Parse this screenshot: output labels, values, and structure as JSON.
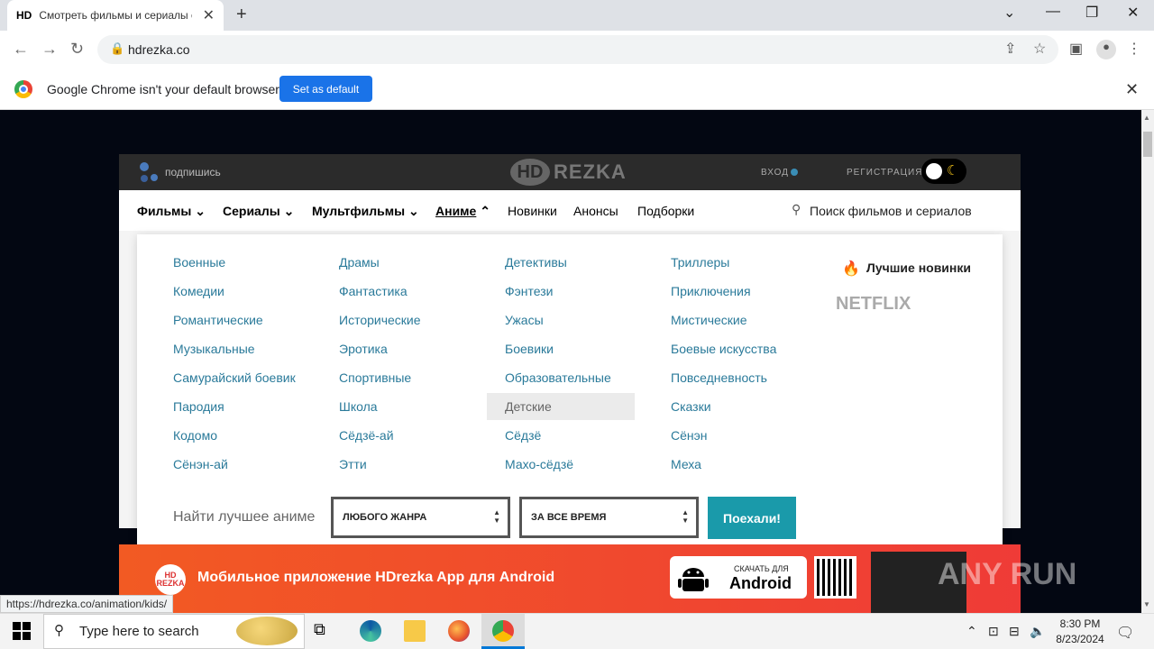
{
  "browser": {
    "tab_favicon": "HD",
    "tab_title": "Смотреть фильмы и сериалы о",
    "new_tab": "+",
    "url": "hdrezka.co",
    "infobar_text": "Google Chrome isn't your default browser",
    "set_default": "Set as default",
    "status_url": "https://hdrezka.co/animation/kids/"
  },
  "site": {
    "subscribe": "подпишись",
    "logo_hd": "HD",
    "logo_rezka": "REZKA",
    "login": "ВХОД",
    "register": "РЕГИСТРАЦИЯ",
    "nav": {
      "films": "Фильмы",
      "series": "Сериалы",
      "cartoons": "Мультфильмы",
      "anime": "Аниме",
      "new": "Новинки",
      "announces": "Анонсы",
      "collections": "Подборки",
      "search": "Поиск фильмов и сериалов"
    },
    "genres_col1": [
      "Военные",
      "Комедии",
      "Романтические",
      "Музыкальные",
      "Самурайский боевик",
      "Пародия",
      "Кодомо",
      "Сёнэн-ай"
    ],
    "genres_col2": [
      "Драмы",
      "Фантастика",
      "Исторические",
      "Эротика",
      "Спортивные",
      "Школа",
      "Сёдзё-ай",
      "Этти"
    ],
    "genres_col3": [
      "Детективы",
      "Фэнтези",
      "Ужасы",
      "Боевики",
      "Образовательные",
      "Детские",
      "Сёдзё",
      "Махо-сёдзё"
    ],
    "genres_col4": [
      "Триллеры",
      "Приключения",
      "Мистические",
      "Боевые искусства",
      "Повседневность",
      "Сказки",
      "Сёнэн",
      "Меха"
    ],
    "best_new": "Лучшие новинки",
    "netflix": "NETFLIX",
    "find_label": "Найти лучшее аниме",
    "genre_select": "ЛЮБОГО ЖАНРА",
    "time_select": "ЗА ВСЕ ВРЕМЯ",
    "go": "Поехали!",
    "banner_logo": "HD\nREZKA",
    "banner_text": "Мобильное приложение HDrezka App для Android",
    "download_small": "СКАЧАТЬ ДЛЯ",
    "download_big": "Android",
    "watermark": "ANY RUN"
  },
  "taskbar": {
    "search_placeholder": "Type here to search",
    "time": "8:30 PM",
    "date": "8/23/2024"
  }
}
